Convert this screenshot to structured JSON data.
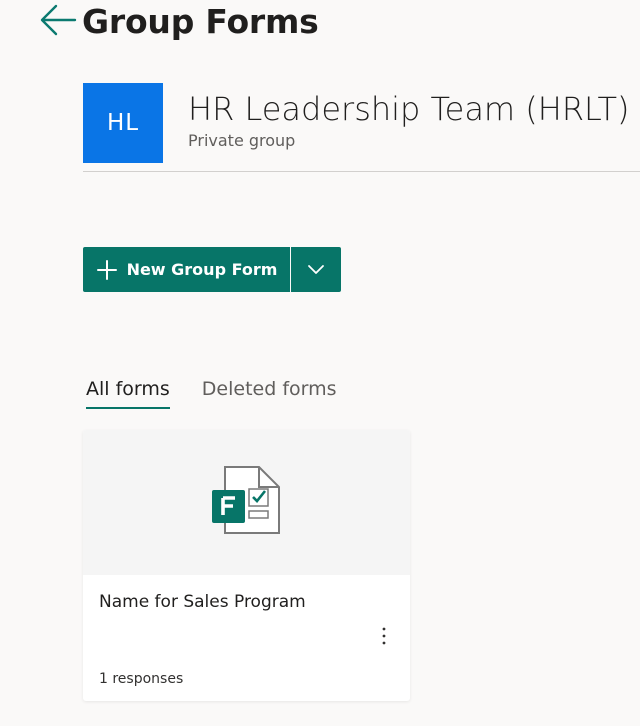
{
  "header": {
    "title": "Group Forms",
    "back_icon": "arrow-left-icon"
  },
  "group": {
    "initials": "HL",
    "name": "HR Leadership Team (HRLT)",
    "type": "Private group",
    "avatar_color": "#0a75e6"
  },
  "actions": {
    "new_form_label": "New Group Form",
    "accent_color": "#077568"
  },
  "tabs": [
    {
      "label": "All forms",
      "active": true
    },
    {
      "label": "Deleted forms",
      "active": false
    }
  ],
  "forms": [
    {
      "title": "Name for Sales Program",
      "responses": "1 responses",
      "icon": "forms-file-icon"
    }
  ]
}
